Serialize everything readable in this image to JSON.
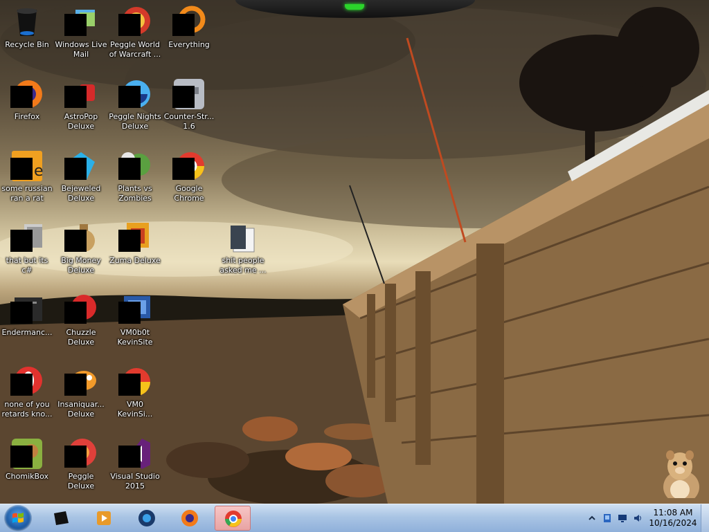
{
  "desktop": {
    "icons": [
      {
        "label": "Recycle Bin",
        "icon": "recycle-bin-icon",
        "masked": false
      },
      {
        "label": "Windows Live\nMail",
        "icon": "windows-live-mail-icon",
        "masked": true
      },
      {
        "label": "Peggle World\nof Warcraft ...",
        "icon": "peggle-wow-icon",
        "masked": true
      },
      {
        "label": "Everything",
        "icon": "everything-search-icon",
        "masked": true
      },
      {
        "label": "Firefox",
        "icon": "firefox-icon",
        "masked": true
      },
      {
        "label": "AstroPop\nDeluxe",
        "icon": "astropop-icon",
        "masked": true
      },
      {
        "label": "Peggle Nights\nDeluxe",
        "icon": "peggle-nights-icon",
        "masked": true
      },
      {
        "label": "Counter-Str...\n1.6",
        "icon": "counter-strike-icon",
        "masked": true
      },
      {
        "label": "some russian\nran a rat",
        "icon": "java-file-icon",
        "masked": true
      },
      {
        "label": "Bejeweled\nDeluxe",
        "icon": "bejeweled-icon",
        "masked": true
      },
      {
        "label": "Plants vs\nZombies",
        "icon": "plants-vs-zombies-icon",
        "masked": true
      },
      {
        "label": "Google\nChrome",
        "icon": "chrome-icon",
        "masked": true
      },
      {
        "label": "that but its c#",
        "icon": "file-stack-icon",
        "masked": true
      },
      {
        "label": "Big Money\nDeluxe",
        "icon": "money-bag-icon",
        "masked": true
      },
      {
        "label": "Zuma Deluxe",
        "icon": "zuma-icon",
        "masked": true
      },
      {
        "label": "shit people\nasked me ...",
        "icon": "folder-icon",
        "masked": false
      },
      {
        "label": "Endermanc...",
        "icon": "app-window-icon",
        "masked": true
      },
      {
        "label": "Chuzzle\nDeluxe",
        "icon": "chuzzle-icon",
        "masked": true
      },
      {
        "label": "VM0b0t\nKevinSite",
        "icon": "vm-chart-icon",
        "masked": true
      },
      {
        "label": "none of you\nretards kno...",
        "icon": "opera-icon",
        "masked": true
      },
      {
        "label": "Insaniquar...\nDeluxe",
        "icon": "insaniquarium-icon",
        "masked": true
      },
      {
        "label": "VM0\nKevinSi...",
        "icon": "chrome-canary-icon",
        "masked": true
      },
      {
        "label": "ChomikBox",
        "icon": "chomikbox-icon",
        "masked": true
      },
      {
        "label": "Peggle Deluxe",
        "icon": "peggle-icon",
        "masked": true
      },
      {
        "label": "Visual Studio\n2015",
        "icon": "visual-studio-icon",
        "masked": true
      }
    ]
  },
  "taskbar": {
    "start": {
      "icon": "windows-start-icon"
    },
    "pinned": [
      {
        "icon": "terminal-icon",
        "active": false
      },
      {
        "icon": "media-player-icon",
        "active": false
      },
      {
        "icon": "globe-icon",
        "active": false
      },
      {
        "icon": "firefox-icon",
        "active": false
      },
      {
        "icon": "chrome-icon",
        "active": true
      }
    ],
    "tray": {
      "icons": [
        "show-hidden-icons-chevron",
        "network-icon",
        "display-icon",
        "volume-icon"
      ],
      "time": "11:08 AM",
      "date": "10/16/2024"
    }
  },
  "colors": {
    "taskbar_top": "#cfe0f2",
    "taskbar_bottom": "#8fb0da",
    "active_task": "#f7c5c5",
    "label_text": "#ffffff"
  }
}
